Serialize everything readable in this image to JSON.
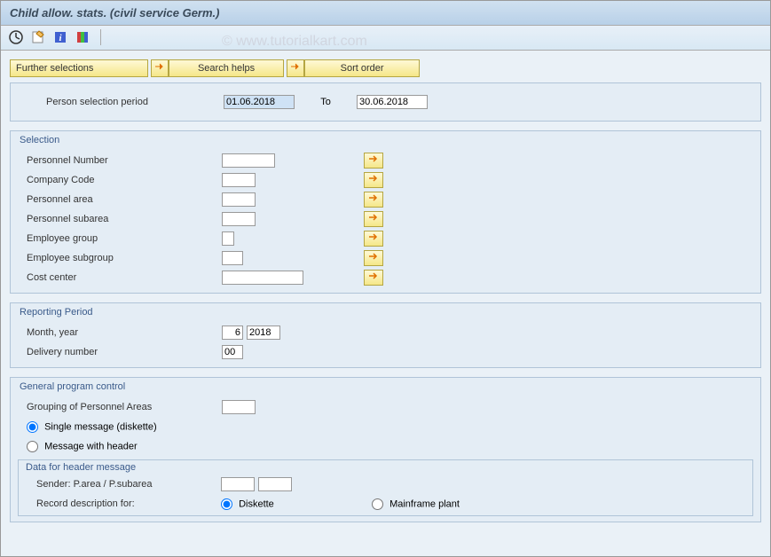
{
  "title": "Child allow. stats. (civil service Germ.)",
  "watermark": "© www.tutorialkart.com",
  "toolbar": {
    "execute": "Execute",
    "variant": "Get Variant",
    "info": "Information",
    "color": "Color Legend"
  },
  "buttons": {
    "further_selections": "Further selections",
    "search_helps": "Search helps",
    "sort_order": "Sort order"
  },
  "period_panel": {
    "label": "Person selection period",
    "from": "01.06.2018",
    "to_label": "To",
    "to": "30.06.2018"
  },
  "selection": {
    "title": "Selection",
    "fields": [
      {
        "label": "Personnel Number",
        "value": "",
        "w": "w60"
      },
      {
        "label": "Company Code",
        "value": "",
        "w": "w40"
      },
      {
        "label": "Personnel area",
        "value": "",
        "w": "w40"
      },
      {
        "label": "Personnel subarea",
        "value": "",
        "w": "w40"
      },
      {
        "label": "Employee group",
        "value": "",
        "w": "w10"
      },
      {
        "label": "Employee subgroup",
        "value": "",
        "w": "w20"
      },
      {
        "label": "Cost center",
        "value": "",
        "w": "w90"
      }
    ]
  },
  "reporting": {
    "title": "Reporting Period",
    "month_year_label": "Month, year",
    "month": "6",
    "year": "2018",
    "delivery_label": "Delivery number",
    "delivery": "00"
  },
  "general": {
    "title": "General program control",
    "grouping_label": "Grouping of Personnel Areas",
    "grouping_value": "",
    "radio_single": "Single message (diskette)",
    "radio_header": "Message with header",
    "header_sub_title": "Data for header message",
    "sender_label": "Sender: P.area / P.subarea",
    "sender_a": "",
    "sender_b": "",
    "record_label": "Record description for:",
    "record_diskette": "Diskette",
    "record_mainframe": "Mainframe plant"
  }
}
